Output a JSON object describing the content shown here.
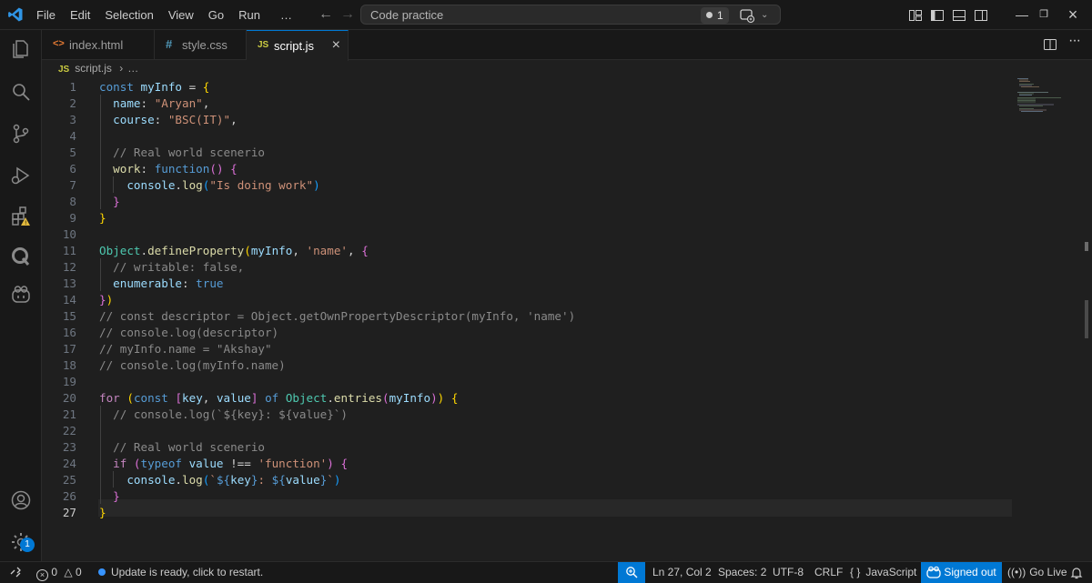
{
  "menu": [
    "File",
    "Edit",
    "Selection",
    "View",
    "Go",
    "Run",
    "…"
  ],
  "command_center": {
    "text": "Code practice",
    "badge": "1"
  },
  "tabs": [
    {
      "icon": "<>",
      "label": "index.html",
      "icon_color": "#e37933"
    },
    {
      "icon": "#",
      "label": "style.css",
      "icon_color": "#519aba"
    },
    {
      "icon": "JS",
      "label": "script.js",
      "icon_color": "#cbcb41",
      "active": true
    }
  ],
  "breadcrumb": {
    "icon": "JS",
    "file": "script.js",
    "sep": "›",
    "more": "…"
  },
  "editor": {
    "lines": [
      {
        "n": "1",
        "parts": [
          [
            "kw",
            "const "
          ],
          [
            "var",
            "myInfo"
          ],
          [
            "op",
            " = "
          ],
          [
            "p1",
            "{"
          ]
        ]
      },
      {
        "n": "2",
        "parts": [
          [
            "op",
            "  "
          ],
          [
            "prop",
            "name"
          ],
          [
            "op",
            ": "
          ],
          [
            "str",
            "\"Aryan\""
          ],
          [
            "op",
            ","
          ]
        ]
      },
      {
        "n": "3",
        "parts": [
          [
            "op",
            "  "
          ],
          [
            "prop",
            "course"
          ],
          [
            "op",
            ": "
          ],
          [
            "str",
            "\"BSC(IT)\""
          ],
          [
            "op",
            ","
          ]
        ]
      },
      {
        "n": "4",
        "parts": []
      },
      {
        "n": "5",
        "parts": [
          [
            "op",
            "  "
          ],
          [
            "comg",
            "// Real world scenerio"
          ]
        ]
      },
      {
        "n": "6",
        "parts": [
          [
            "op",
            "  "
          ],
          [
            "fn",
            "work"
          ],
          [
            "op",
            ": "
          ],
          [
            "kw",
            "function"
          ],
          [
            "p2",
            "()"
          ],
          [
            "op",
            " "
          ],
          [
            "p2",
            "{"
          ]
        ]
      },
      {
        "n": "7",
        "parts": [
          [
            "op",
            "    "
          ],
          [
            "var",
            "console"
          ],
          [
            "op",
            "."
          ],
          [
            "fn",
            "log"
          ],
          [
            "p3",
            "("
          ],
          [
            "str",
            "\"Is doing work\""
          ],
          [
            "p3",
            ")"
          ]
        ]
      },
      {
        "n": "8",
        "parts": [
          [
            "op",
            "  "
          ],
          [
            "p2",
            "}"
          ]
        ]
      },
      {
        "n": "9",
        "parts": [
          [
            "p1",
            "}"
          ]
        ]
      },
      {
        "n": "10",
        "parts": []
      },
      {
        "n": "11",
        "parts": [
          [
            "cls",
            "Object"
          ],
          [
            "op",
            "."
          ],
          [
            "fn",
            "defineProperty"
          ],
          [
            "p1",
            "("
          ],
          [
            "var",
            "myInfo"
          ],
          [
            "op",
            ", "
          ],
          [
            "str",
            "'name'"
          ],
          [
            "op",
            ", "
          ],
          [
            "p2",
            "{"
          ]
        ]
      },
      {
        "n": "12",
        "parts": [
          [
            "op",
            "  "
          ],
          [
            "comg",
            "// writable: false,"
          ]
        ]
      },
      {
        "n": "13",
        "parts": [
          [
            "op",
            "  "
          ],
          [
            "prop",
            "enumerable"
          ],
          [
            "op",
            ": "
          ],
          [
            "kw",
            "true"
          ]
        ]
      },
      {
        "n": "14",
        "parts": [
          [
            "p2",
            "}"
          ],
          [
            "p1",
            ")"
          ]
        ]
      },
      {
        "n": "15",
        "parts": [
          [
            "comg",
            "// const descriptor = Object.getOwnPropertyDescriptor(myInfo, 'name')"
          ]
        ]
      },
      {
        "n": "16",
        "parts": [
          [
            "comg",
            "// console.log(descriptor)"
          ]
        ]
      },
      {
        "n": "17",
        "parts": [
          [
            "comg",
            "// myInfo.name = \"Akshay\""
          ]
        ]
      },
      {
        "n": "18",
        "parts": [
          [
            "comg",
            "// console.log(myInfo.name)"
          ]
        ]
      },
      {
        "n": "19",
        "parts": []
      },
      {
        "n": "20",
        "parts": [
          [
            "ctl",
            "for "
          ],
          [
            "p1",
            "("
          ],
          [
            "kw",
            "const "
          ],
          [
            "p2",
            "["
          ],
          [
            "var",
            "key"
          ],
          [
            "op",
            ", "
          ],
          [
            "var",
            "value"
          ],
          [
            "p2",
            "]"
          ],
          [
            "op",
            " "
          ],
          [
            "kw",
            "of "
          ],
          [
            "cls",
            "Object"
          ],
          [
            "op",
            "."
          ],
          [
            "fn",
            "entries"
          ],
          [
            "p2",
            "("
          ],
          [
            "var",
            "myInfo"
          ],
          [
            "p2",
            ")"
          ],
          [
            "p1",
            ")"
          ],
          [
            "op",
            " "
          ],
          [
            "p1",
            "{"
          ]
        ]
      },
      {
        "n": "21",
        "parts": [
          [
            "op",
            "  "
          ],
          [
            "comg",
            "// console.log(`${key}: ${value}`)"
          ]
        ]
      },
      {
        "n": "22",
        "parts": []
      },
      {
        "n": "23",
        "parts": [
          [
            "op",
            "  "
          ],
          [
            "comg",
            "// Real world scenerio"
          ]
        ]
      },
      {
        "n": "24",
        "parts": [
          [
            "op",
            "  "
          ],
          [
            "ctl",
            "if "
          ],
          [
            "p2",
            "("
          ],
          [
            "kw",
            "typeof "
          ],
          [
            "var",
            "value"
          ],
          [
            "op",
            " !== "
          ],
          [
            "str",
            "'function'"
          ],
          [
            "p2",
            ")"
          ],
          [
            "op",
            " "
          ],
          [
            "p2",
            "{"
          ]
        ]
      },
      {
        "n": "25",
        "parts": [
          [
            "op",
            "    "
          ],
          [
            "var",
            "console"
          ],
          [
            "op",
            "."
          ],
          [
            "fn",
            "log"
          ],
          [
            "p3",
            "("
          ],
          [
            "str",
            "`"
          ],
          [
            "kw",
            "${"
          ],
          [
            "var",
            "key"
          ],
          [
            "kw",
            "}"
          ],
          [
            "str",
            ": "
          ],
          [
            "kw",
            "${"
          ],
          [
            "var",
            "value"
          ],
          [
            "kw",
            "}"
          ],
          [
            "str",
            "`"
          ],
          [
            "p3",
            ")"
          ]
        ]
      },
      {
        "n": "26",
        "parts": [
          [
            "op",
            "  "
          ],
          [
            "p2",
            "}"
          ]
        ]
      },
      {
        "n": "27",
        "parts": [
          [
            "p1",
            "}"
          ]
        ],
        "current": true
      }
    ]
  },
  "status": {
    "errors": "0",
    "warnings": "0",
    "notification": "Update is ready, click to restart.",
    "position": "Ln 27, Col 2",
    "spaces": "Spaces: 2",
    "encoding": "UTF-8",
    "eol": "CRLF",
    "language": "JavaScript",
    "language_icon": "{ }",
    "account": "Signed out",
    "live": "Go Live"
  },
  "activity_badge": "1",
  "colors": {
    "accent": "#0078d4",
    "background": "#1f1f1f",
    "chrome": "#181818"
  }
}
